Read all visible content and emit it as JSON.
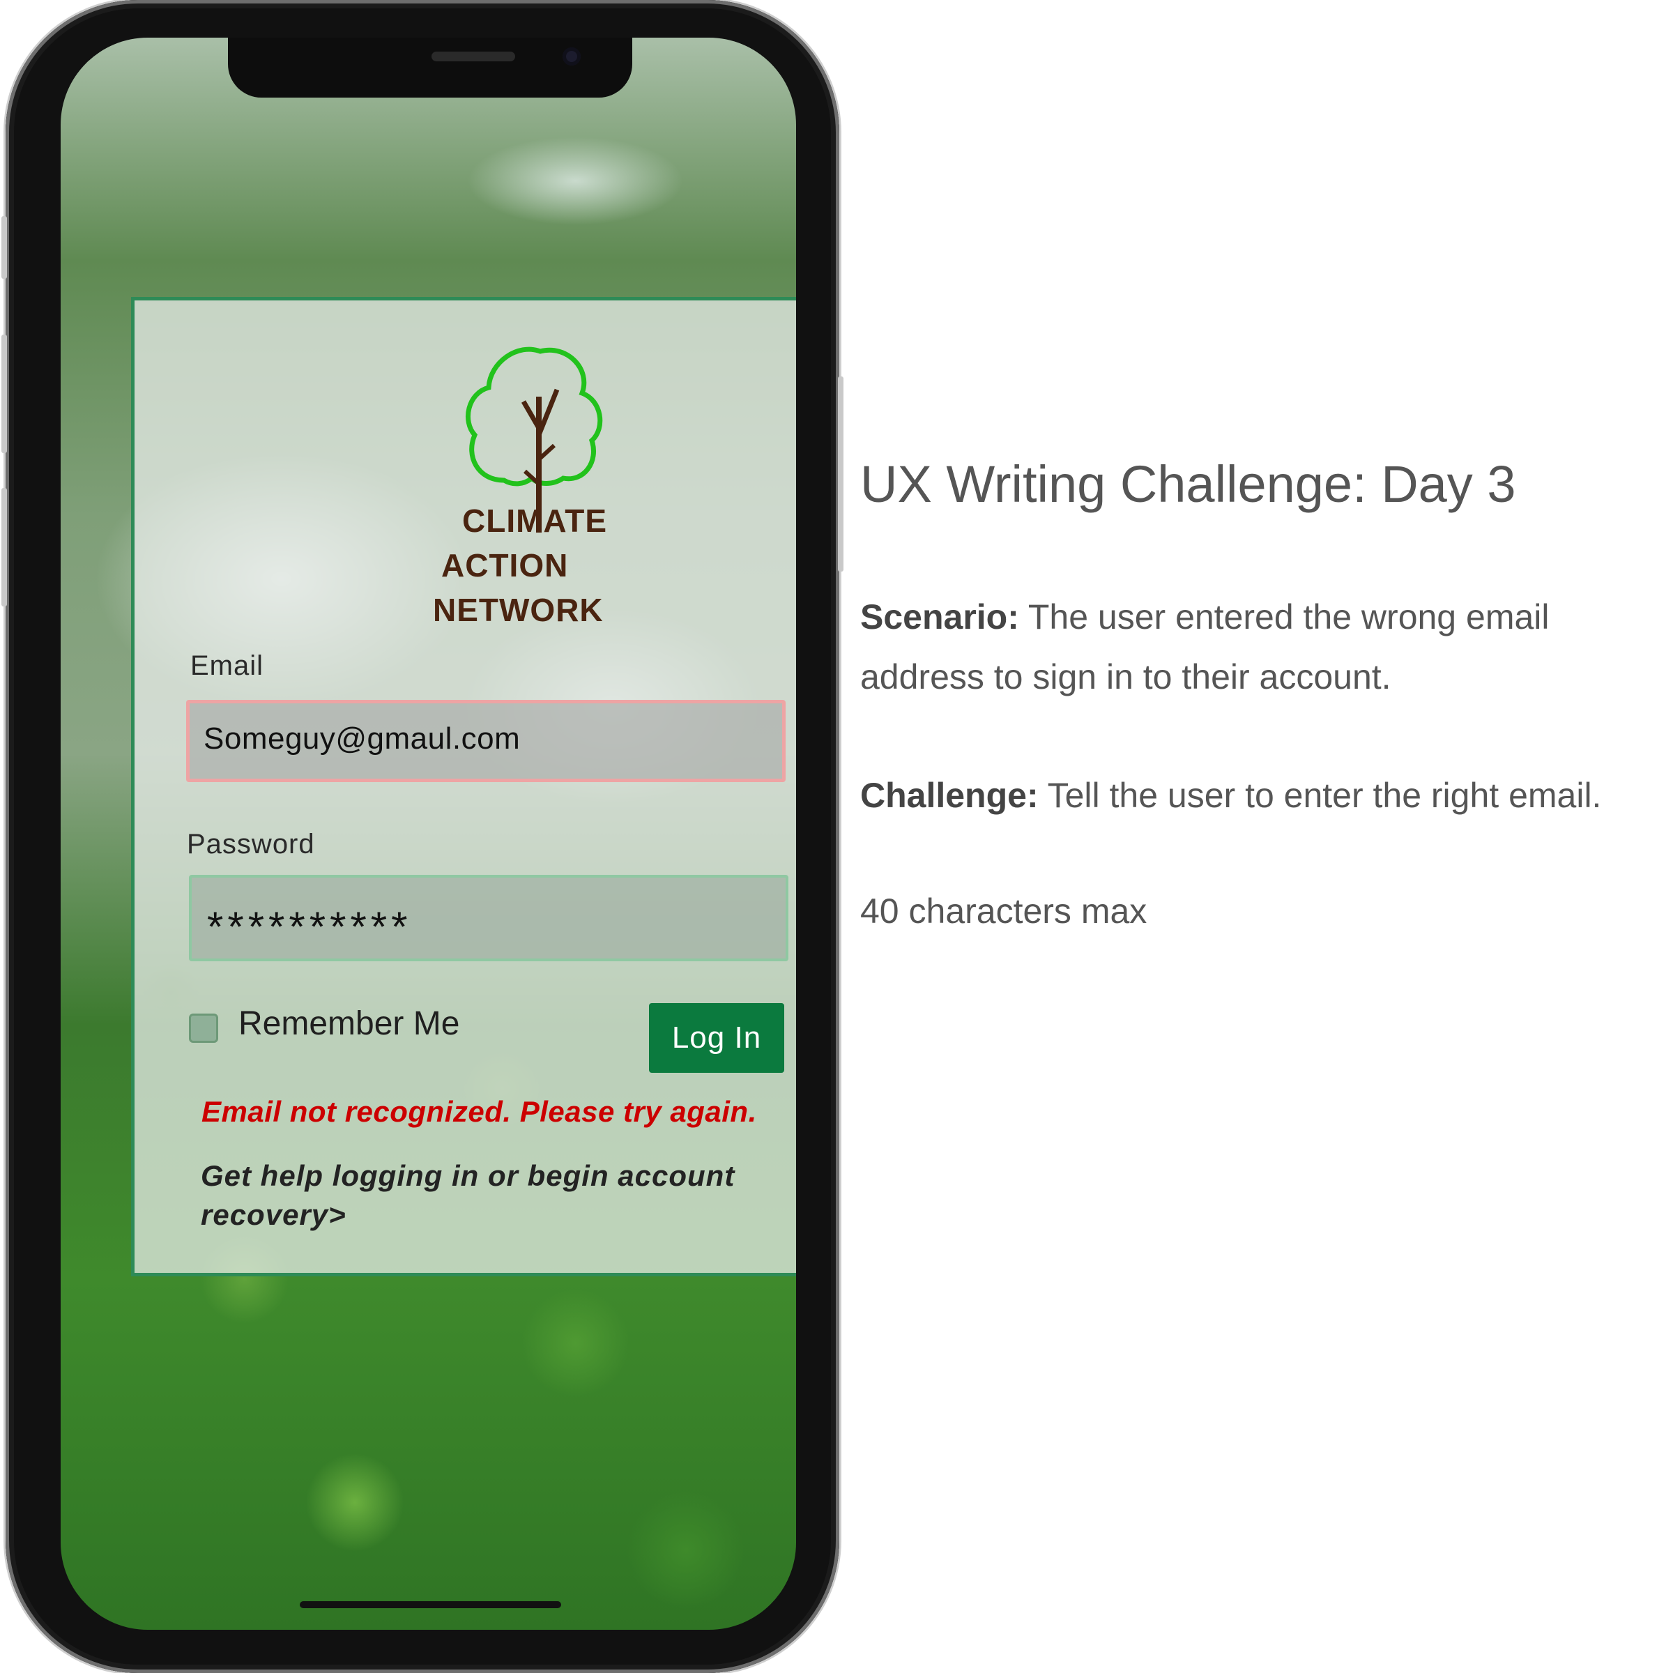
{
  "app": {
    "logo_lines": [
      "CLIMATE",
      "ACTION",
      "NETWORK"
    ],
    "colors": {
      "brand_green": "#0b7a3e",
      "card_border": "#2e8b57",
      "error_red": "#cc0000",
      "logo_green": "#22c21c",
      "logo_brown": "#4a2410"
    }
  },
  "login": {
    "email_label": "Email",
    "email_value": "Someguy@gmaul.com",
    "password_label": "Password",
    "password_value": "**********",
    "remember_label": "Remember Me",
    "login_button": "Log In",
    "error_message": "Email not recognized. Please try again.",
    "help_line1": "Get help logging in or begin account",
    "help_line2": "recovery>"
  },
  "challenge": {
    "title": "UX Writing Challenge: Day 3",
    "scenario_label": "Scenario:",
    "scenario_text_1": "The user entered the wrong email",
    "scenario_text_2": "address to sign in to their account.",
    "challenge_label": "Challenge:",
    "challenge_text": "Tell the user to enter the right email.",
    "limit": "40 characters max"
  }
}
